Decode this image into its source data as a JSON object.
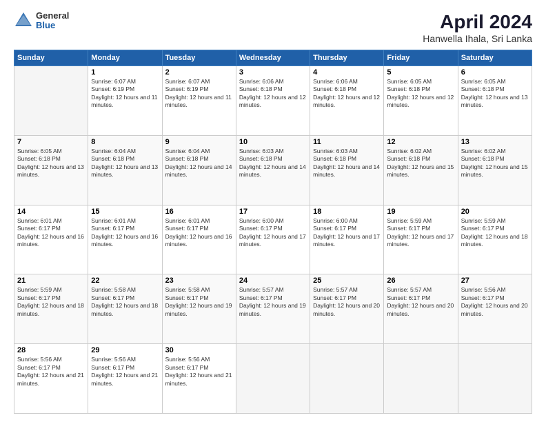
{
  "logo": {
    "general": "General",
    "blue": "Blue"
  },
  "header": {
    "title": "April 2024",
    "subtitle": "Hanwella Ihala, Sri Lanka"
  },
  "weekdays": [
    "Sunday",
    "Monday",
    "Tuesday",
    "Wednesday",
    "Thursday",
    "Friday",
    "Saturday"
  ],
  "weeks": [
    [
      {
        "day": "",
        "sunrise": "",
        "sunset": "",
        "daylight": ""
      },
      {
        "day": "1",
        "sunrise": "Sunrise: 6:07 AM",
        "sunset": "Sunset: 6:19 PM",
        "daylight": "Daylight: 12 hours and 11 minutes."
      },
      {
        "day": "2",
        "sunrise": "Sunrise: 6:07 AM",
        "sunset": "Sunset: 6:19 PM",
        "daylight": "Daylight: 12 hours and 11 minutes."
      },
      {
        "day": "3",
        "sunrise": "Sunrise: 6:06 AM",
        "sunset": "Sunset: 6:18 PM",
        "daylight": "Daylight: 12 hours and 12 minutes."
      },
      {
        "day": "4",
        "sunrise": "Sunrise: 6:06 AM",
        "sunset": "Sunset: 6:18 PM",
        "daylight": "Daylight: 12 hours and 12 minutes."
      },
      {
        "day": "5",
        "sunrise": "Sunrise: 6:05 AM",
        "sunset": "Sunset: 6:18 PM",
        "daylight": "Daylight: 12 hours and 12 minutes."
      },
      {
        "day": "6",
        "sunrise": "Sunrise: 6:05 AM",
        "sunset": "Sunset: 6:18 PM",
        "daylight": "Daylight: 12 hours and 13 minutes."
      }
    ],
    [
      {
        "day": "7",
        "sunrise": "Sunrise: 6:05 AM",
        "sunset": "Sunset: 6:18 PM",
        "daylight": "Daylight: 12 hours and 13 minutes."
      },
      {
        "day": "8",
        "sunrise": "Sunrise: 6:04 AM",
        "sunset": "Sunset: 6:18 PM",
        "daylight": "Daylight: 12 hours and 13 minutes."
      },
      {
        "day": "9",
        "sunrise": "Sunrise: 6:04 AM",
        "sunset": "Sunset: 6:18 PM",
        "daylight": "Daylight: 12 hours and 14 minutes."
      },
      {
        "day": "10",
        "sunrise": "Sunrise: 6:03 AM",
        "sunset": "Sunset: 6:18 PM",
        "daylight": "Daylight: 12 hours and 14 minutes."
      },
      {
        "day": "11",
        "sunrise": "Sunrise: 6:03 AM",
        "sunset": "Sunset: 6:18 PM",
        "daylight": "Daylight: 12 hours and 14 minutes."
      },
      {
        "day": "12",
        "sunrise": "Sunrise: 6:02 AM",
        "sunset": "Sunset: 6:18 PM",
        "daylight": "Daylight: 12 hours and 15 minutes."
      },
      {
        "day": "13",
        "sunrise": "Sunrise: 6:02 AM",
        "sunset": "Sunset: 6:18 PM",
        "daylight": "Daylight: 12 hours and 15 minutes."
      }
    ],
    [
      {
        "day": "14",
        "sunrise": "Sunrise: 6:01 AM",
        "sunset": "Sunset: 6:17 PM",
        "daylight": "Daylight: 12 hours and 16 minutes."
      },
      {
        "day": "15",
        "sunrise": "Sunrise: 6:01 AM",
        "sunset": "Sunset: 6:17 PM",
        "daylight": "Daylight: 12 hours and 16 minutes."
      },
      {
        "day": "16",
        "sunrise": "Sunrise: 6:01 AM",
        "sunset": "Sunset: 6:17 PM",
        "daylight": "Daylight: 12 hours and 16 minutes."
      },
      {
        "day": "17",
        "sunrise": "Sunrise: 6:00 AM",
        "sunset": "Sunset: 6:17 PM",
        "daylight": "Daylight: 12 hours and 17 minutes."
      },
      {
        "day": "18",
        "sunrise": "Sunrise: 6:00 AM",
        "sunset": "Sunset: 6:17 PM",
        "daylight": "Daylight: 12 hours and 17 minutes."
      },
      {
        "day": "19",
        "sunrise": "Sunrise: 5:59 AM",
        "sunset": "Sunset: 6:17 PM",
        "daylight": "Daylight: 12 hours and 17 minutes."
      },
      {
        "day": "20",
        "sunrise": "Sunrise: 5:59 AM",
        "sunset": "Sunset: 6:17 PM",
        "daylight": "Daylight: 12 hours and 18 minutes."
      }
    ],
    [
      {
        "day": "21",
        "sunrise": "Sunrise: 5:59 AM",
        "sunset": "Sunset: 6:17 PM",
        "daylight": "Daylight: 12 hours and 18 minutes."
      },
      {
        "day": "22",
        "sunrise": "Sunrise: 5:58 AM",
        "sunset": "Sunset: 6:17 PM",
        "daylight": "Daylight: 12 hours and 18 minutes."
      },
      {
        "day": "23",
        "sunrise": "Sunrise: 5:58 AM",
        "sunset": "Sunset: 6:17 PM",
        "daylight": "Daylight: 12 hours and 19 minutes."
      },
      {
        "day": "24",
        "sunrise": "Sunrise: 5:57 AM",
        "sunset": "Sunset: 6:17 PM",
        "daylight": "Daylight: 12 hours and 19 minutes."
      },
      {
        "day": "25",
        "sunrise": "Sunrise: 5:57 AM",
        "sunset": "Sunset: 6:17 PM",
        "daylight": "Daylight: 12 hours and 20 minutes."
      },
      {
        "day": "26",
        "sunrise": "Sunrise: 5:57 AM",
        "sunset": "Sunset: 6:17 PM",
        "daylight": "Daylight: 12 hours and 20 minutes."
      },
      {
        "day": "27",
        "sunrise": "Sunrise: 5:56 AM",
        "sunset": "Sunset: 6:17 PM",
        "daylight": "Daylight: 12 hours and 20 minutes."
      }
    ],
    [
      {
        "day": "28",
        "sunrise": "Sunrise: 5:56 AM",
        "sunset": "Sunset: 6:17 PM",
        "daylight": "Daylight: 12 hours and 21 minutes."
      },
      {
        "day": "29",
        "sunrise": "Sunrise: 5:56 AM",
        "sunset": "Sunset: 6:17 PM",
        "daylight": "Daylight: 12 hours and 21 minutes."
      },
      {
        "day": "30",
        "sunrise": "Sunrise: 5:56 AM",
        "sunset": "Sunset: 6:17 PM",
        "daylight": "Daylight: 12 hours and 21 minutes."
      },
      {
        "day": "",
        "sunrise": "",
        "sunset": "",
        "daylight": ""
      },
      {
        "day": "",
        "sunrise": "",
        "sunset": "",
        "daylight": ""
      },
      {
        "day": "",
        "sunrise": "",
        "sunset": "",
        "daylight": ""
      },
      {
        "day": "",
        "sunrise": "",
        "sunset": "",
        "daylight": ""
      }
    ]
  ]
}
